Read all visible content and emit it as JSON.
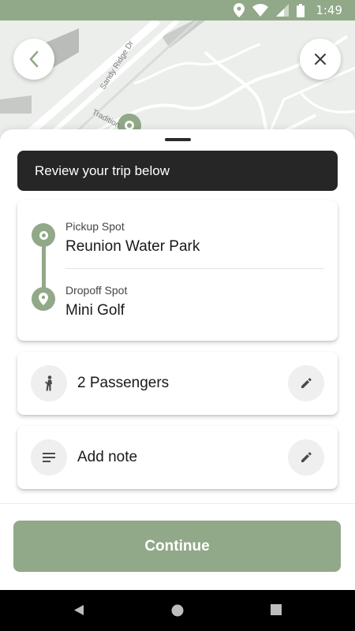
{
  "status_bar": {
    "time": "1:49",
    "background_color": "#91a988",
    "icons": [
      "location-icon",
      "wifi-icon",
      "signal-icon",
      "battery-icon"
    ]
  },
  "map": {
    "street_labels": [
      "Sandy Ridge Dr",
      "Tradition"
    ]
  },
  "header": {
    "back_icon": "chevron-left-icon",
    "close_icon": "close-icon"
  },
  "sheet": {
    "banner_text": "Review your trip below",
    "route": {
      "pickup_label": "Pickup Spot",
      "pickup_name": "Reunion Water Park",
      "dropoff_label": "Dropoff Spot",
      "dropoff_name": "Mini Golf"
    },
    "passengers": {
      "text": "2 Passengers",
      "icon": "person-icon",
      "edit_icon": "pencil-icon"
    },
    "note": {
      "text": "Add note",
      "icon": "notes-icon",
      "edit_icon": "pencil-icon"
    },
    "continue_label": "Continue"
  },
  "colors": {
    "accent": "#91a988",
    "banner_bg": "#262626"
  },
  "nav_bar": {
    "icons": [
      "back-triangle-icon",
      "home-circle-icon",
      "recents-square-icon"
    ]
  }
}
